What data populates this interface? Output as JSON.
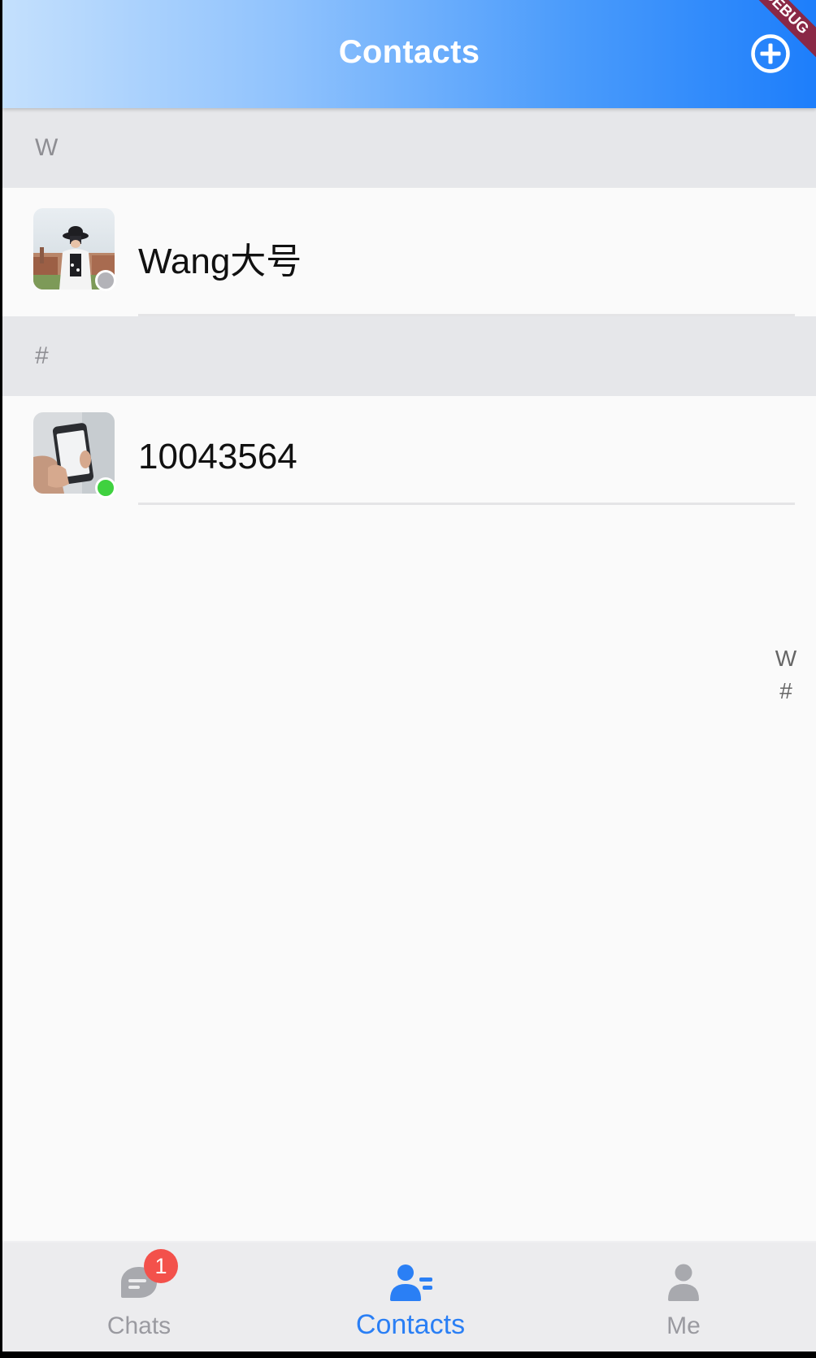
{
  "header": {
    "title": "Contacts",
    "add_icon": "add-circle-icon",
    "debug_ribbon": "DEBUG"
  },
  "sections": [
    {
      "letter": "W",
      "contacts": [
        {
          "name": "Wang大号",
          "avatar": "woman-with-camera-photo",
          "status": "offline",
          "status_color": "#b3b3b8"
        }
      ]
    },
    {
      "letter": "#",
      "contacts": [
        {
          "name": "10043564",
          "avatar": "hand-holding-phone-photo",
          "status": "online",
          "status_color": "#3fd13f"
        }
      ]
    }
  ],
  "index_bar": {
    "letters": [
      "W",
      "#"
    ]
  },
  "bottom_nav": {
    "items": [
      {
        "label": "Chats",
        "icon": "chat-bubble-icon",
        "badge": "1",
        "active": false
      },
      {
        "label": "Contacts",
        "icon": "contacts-icon",
        "active": true
      },
      {
        "label": "Me",
        "icon": "person-icon",
        "active": false
      }
    ]
  },
  "colors": {
    "accent": "#2a7ff5",
    "badge": "#f3514b",
    "online": "#3fd13f",
    "offline": "#b3b3b8"
  }
}
